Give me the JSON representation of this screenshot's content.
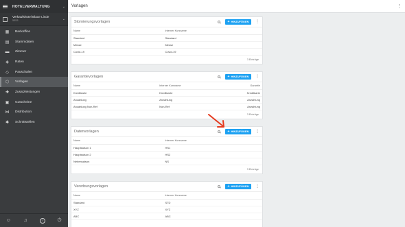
{
  "sidebar": {
    "app_title": "HOTELVERWALTUNG",
    "hotel": {
      "name": "Verkaufshotel Blaue Linde",
      "id": "5353"
    },
    "items": [
      {
        "label": "Backoffice",
        "icon": "building-icon",
        "glyph": "▦"
      },
      {
        "label": "Stammdaten",
        "icon": "database-icon",
        "glyph": "▤"
      },
      {
        "label": "Zimmer",
        "icon": "bed-icon",
        "glyph": "▬"
      },
      {
        "label": "Raten",
        "icon": "tag-icon",
        "glyph": "◈"
      },
      {
        "label": "Pauschalen",
        "icon": "package-icon",
        "glyph": "◇"
      },
      {
        "label": "Vorlagen",
        "icon": "template-icon",
        "glyph": "⬡"
      },
      {
        "label": "Zusatzleistungen",
        "icon": "extras-icon",
        "glyph": "✚"
      },
      {
        "label": "Gutscheine",
        "icon": "voucher-icon",
        "glyph": "▣"
      },
      {
        "label": "Distribution",
        "icon": "distribution-icon",
        "glyph": "⋈"
      },
      {
        "label": "Schnittstellen",
        "icon": "interfaces-icon",
        "glyph": "✱"
      }
    ],
    "active_index": 5,
    "bottom_icons": [
      "user-icon",
      "bell-icon",
      "help-icon",
      "power-icon"
    ]
  },
  "topbar": {
    "title": "Vorlagen"
  },
  "add_label": "HINZUFÜGEN",
  "cards": {
    "storno": {
      "title": "Stornierungsvorlagen",
      "columns": [
        "Name",
        "Interner Kursname"
      ],
      "rows": [
        [
          "Standard",
          "Standard"
        ],
        [
          "Messe",
          "Messe"
        ],
        [
          "Covid-19",
          "Covid-19"
        ]
      ],
      "footer": "3 Einträge"
    },
    "garantie": {
      "title": "Garantievorlagen",
      "columns": [
        "Name",
        "Interner Kursname",
        "Garantie"
      ],
      "rows": [
        [
          "Kreditkarte",
          "Kreditkarte",
          "Kreditkarte"
        ],
        [
          "Anzahlung",
          "Anzahlung",
          "Anzahlung"
        ],
        [
          "Anzahlung Non-Ref",
          "Non-Ref",
          "Anzahlung"
        ]
      ],
      "footer": "3 Einträge"
    },
    "daten": {
      "title": "Datenvorlagen",
      "columns": [
        "Name",
        "Interner Kursname"
      ],
      "rows": [
        [
          "Hauptsaison 1",
          "HS1"
        ],
        [
          "Hauptsaison 2",
          "HS2"
        ],
        [
          "Nebensaison",
          "NS"
        ]
      ],
      "footer": "3 Einträge"
    },
    "vererbung": {
      "title": "Vererbungsvorlagen",
      "columns": [
        "Name",
        "Interner Kursname"
      ],
      "rows": [
        [
          "Standard",
          "STD"
        ],
        [
          "XYZ",
          "XYZ"
        ],
        [
          "ABC",
          "ABC"
        ]
      ]
    }
  },
  "colors": {
    "accent": "#1da1f2",
    "sidebar": "#3a3c3e",
    "annotation": "#e53a1e"
  }
}
